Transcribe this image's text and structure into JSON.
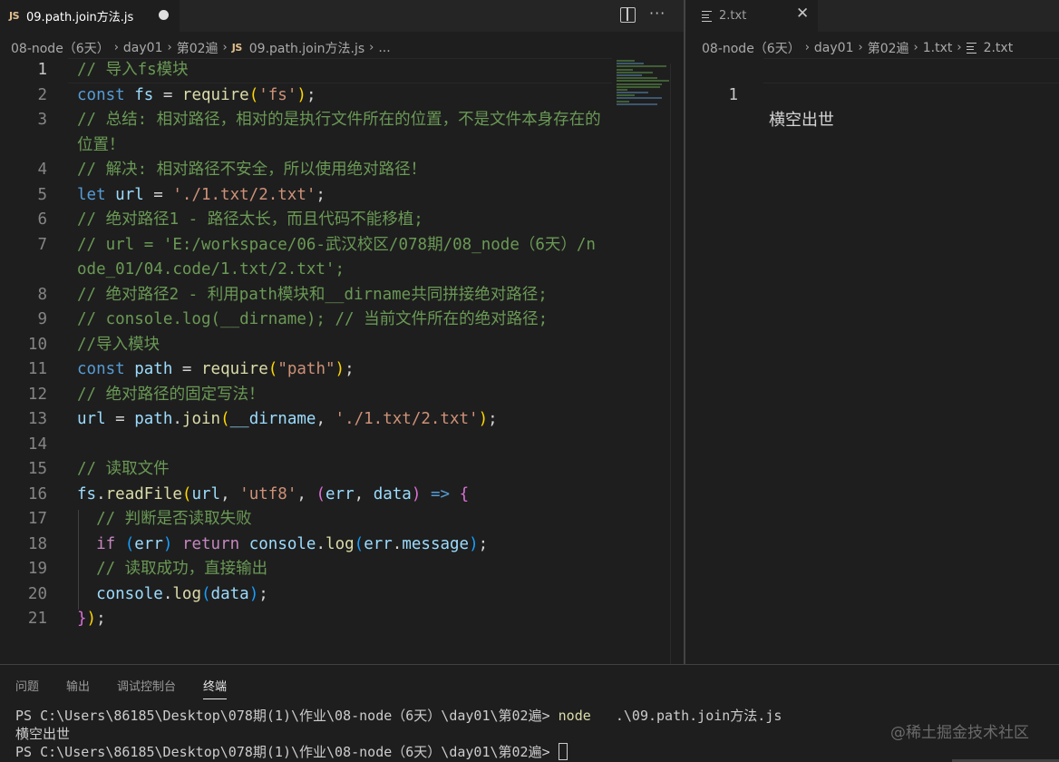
{
  "left_editor": {
    "tab": {
      "badge": "JS",
      "label": "09.path.join方法.js"
    },
    "breadcrumb": [
      "08-node（6天）",
      "day01",
      "第02遍",
      "JS",
      "09.path.join方法.js",
      "..."
    ],
    "lines": [
      {
        "n": "1",
        "active": true,
        "tokens": [
          [
            "c",
            "// 导入fs模块"
          ]
        ]
      },
      {
        "n": "2",
        "tokens": [
          [
            "k",
            "const"
          ],
          [
            "t",
            " "
          ],
          [
            "v",
            "fs"
          ],
          [
            "t",
            " = "
          ],
          [
            "f",
            "require"
          ],
          [
            "p",
            "("
          ],
          [
            "s",
            "'fs'"
          ],
          [
            "p",
            ")"
          ],
          [
            "t",
            ";"
          ]
        ]
      },
      {
        "n": "3",
        "wrap": true,
        "tokens": [
          [
            "c",
            "// 总结: 相对路径，相对的是执行文件所在的位置，不是文件本身存在的位置！"
          ]
        ]
      },
      {
        "n": "4",
        "tokens": [
          [
            "c",
            "// 解决: 相对路径不安全，所以使用绝对路径！"
          ]
        ]
      },
      {
        "n": "5",
        "tokens": [
          [
            "k",
            "let"
          ],
          [
            "t",
            " "
          ],
          [
            "v",
            "url"
          ],
          [
            "t",
            " = "
          ],
          [
            "s",
            "'./1.txt/2.txt'"
          ],
          [
            "t",
            ";"
          ]
        ]
      },
      {
        "n": "6",
        "tokens": [
          [
            "c",
            "// 绝对路径1 - 路径太长，而且代码不能移植;"
          ]
        ]
      },
      {
        "n": "7",
        "wrap": true,
        "tokens": [
          [
            "c",
            "// url = 'E:/workspace/06-武汉校区/078期/08_node（6天）/node_01/04.code/1.txt/2.txt';"
          ]
        ]
      },
      {
        "n": "8",
        "tokens": [
          [
            "c",
            "// 绝对路径2 - 利用path模块和__dirname共同拼接绝对路径;"
          ]
        ]
      },
      {
        "n": "9",
        "tokens": [
          [
            "c",
            "// console.log(__dirname); // 当前文件所在的绝对路径;"
          ]
        ]
      },
      {
        "n": "10",
        "tokens": [
          [
            "c",
            "//导入模块"
          ]
        ]
      },
      {
        "n": "11",
        "tokens": [
          [
            "k",
            "const"
          ],
          [
            "t",
            " "
          ],
          [
            "v",
            "path"
          ],
          [
            "t",
            " = "
          ],
          [
            "f",
            "require"
          ],
          [
            "p",
            "("
          ],
          [
            "s",
            "\"path\""
          ],
          [
            "p",
            ")"
          ],
          [
            "t",
            ";"
          ]
        ]
      },
      {
        "n": "12",
        "tokens": [
          [
            "c",
            "// 绝对路径的固定写法！"
          ]
        ]
      },
      {
        "n": "13",
        "tokens": [
          [
            "v",
            "url"
          ],
          [
            "t",
            " = "
          ],
          [
            "v",
            "path"
          ],
          [
            "t",
            "."
          ],
          [
            "f",
            "join"
          ],
          [
            "p",
            "("
          ],
          [
            "v",
            "__dirname"
          ],
          [
            "t",
            ", "
          ],
          [
            "s",
            "'./1.txt/2.txt'"
          ],
          [
            "p",
            ")"
          ],
          [
            "t",
            ";"
          ]
        ]
      },
      {
        "n": "14",
        "tokens": []
      },
      {
        "n": "15",
        "tokens": [
          [
            "c",
            "// 读取文件"
          ]
        ]
      },
      {
        "n": "16",
        "tokens": [
          [
            "v",
            "fs"
          ],
          [
            "t",
            "."
          ],
          [
            "f",
            "readFile"
          ],
          [
            "p",
            "("
          ],
          [
            "v",
            "url"
          ],
          [
            "t",
            ", "
          ],
          [
            "s",
            "'utf8'"
          ],
          [
            "t",
            ", "
          ],
          [
            "p2",
            "("
          ],
          [
            "v",
            "err"
          ],
          [
            "t",
            ", "
          ],
          [
            "v",
            "data"
          ],
          [
            "p2",
            ")"
          ],
          [
            "t",
            " "
          ],
          [
            "k",
            "=>"
          ],
          [
            "t",
            " "
          ],
          [
            "p2",
            "{"
          ]
        ]
      },
      {
        "n": "17",
        "tokens": [
          [
            "t",
            "  "
          ],
          [
            "c",
            "// 判断是否读取失败"
          ]
        ]
      },
      {
        "n": "18",
        "tokens": [
          [
            "t",
            "  "
          ],
          [
            "kf",
            "if"
          ],
          [
            "t",
            " "
          ],
          [
            "p3",
            "("
          ],
          [
            "v",
            "err"
          ],
          [
            "p3",
            ")"
          ],
          [
            "t",
            " "
          ],
          [
            "kf",
            "return"
          ],
          [
            "t",
            " "
          ],
          [
            "v",
            "console"
          ],
          [
            "t",
            "."
          ],
          [
            "f",
            "log"
          ],
          [
            "p3",
            "("
          ],
          [
            "v",
            "err"
          ],
          [
            "t",
            "."
          ],
          [
            "v",
            "message"
          ],
          [
            "p3",
            ")"
          ],
          [
            "t",
            ";"
          ]
        ]
      },
      {
        "n": "19",
        "tokens": [
          [
            "t",
            "  "
          ],
          [
            "c",
            "// 读取成功，直接输出"
          ]
        ]
      },
      {
        "n": "20",
        "tokens": [
          [
            "t",
            "  "
          ],
          [
            "v",
            "console"
          ],
          [
            "t",
            "."
          ],
          [
            "f",
            "log"
          ],
          [
            "p3",
            "("
          ],
          [
            "v",
            "data"
          ],
          [
            "p3",
            ")"
          ],
          [
            "t",
            ";"
          ]
        ]
      },
      {
        "n": "21",
        "tokens": [
          [
            "p2",
            "}"
          ],
          [
            "p",
            ")"
          ],
          [
            "t",
            ";"
          ]
        ]
      }
    ]
  },
  "right_editor": {
    "tab": {
      "label": "2.txt"
    },
    "breadcrumb": [
      "08-node（6天）",
      "day01",
      "第02遍",
      "1.txt",
      "2.txt"
    ],
    "line_number": "1",
    "content": "横空出世"
  },
  "panel": {
    "tabs": [
      "问题",
      "输出",
      "调试控制台",
      "终端"
    ],
    "active_tab_index": 3,
    "terminal": {
      "prompt1": "PS C:\\Users\\86185\\Desktop\\078期(1)\\作业\\08-node（6天）\\day01\\第02遍> ",
      "command": "node",
      "args": "   .\\09.path.join方法.js",
      "output": "横空出世",
      "prompt2": "PS C:\\Users\\86185\\Desktop\\078期(1)\\作业\\08-node（6天）\\day01\\第02遍> "
    },
    "watermark": "@稀土掘金技术社区"
  },
  "icons": {
    "split": "split-editor-icon",
    "more": "more-actions-icon",
    "close": "close-icon",
    "file": "text-file-icon"
  }
}
